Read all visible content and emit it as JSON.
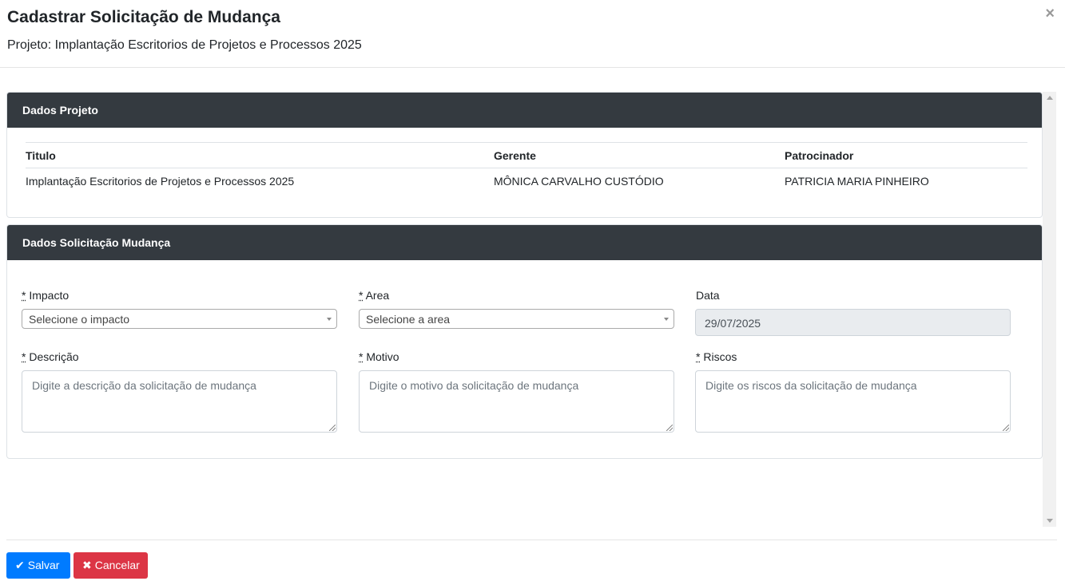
{
  "header": {
    "title": "Cadastrar Solicitação de Mudança",
    "subtitle": "Projeto: Implantação Escritorios de Projetos e Processos 2025",
    "close_symbol": "×"
  },
  "project_card": {
    "title": "Dados Projeto",
    "columns": [
      "Titulo",
      "Gerente",
      "Patrocinador"
    ],
    "row": [
      "Implantação Escritorios de Projetos e Processos 2025",
      "MÔNICA CARVALHO CUSTÓDIO",
      "PATRICIA MARIA PINHEIRO"
    ]
  },
  "request_card": {
    "title": "Dados Solicitação Mudança",
    "required_mark": "*",
    "impacto": {
      "label": "Impacto",
      "value": "Selecione o impacto"
    },
    "area": {
      "label": "Area",
      "value": "Selecione a area"
    },
    "data": {
      "label": "Data",
      "value": "29/07/2025"
    },
    "descricao": {
      "label": "Descrição",
      "placeholder": "Digite a descrição da solicitação de mudança"
    },
    "motivo": {
      "label": "Motivo",
      "placeholder": "Digite o motivo da solicitação de mudança"
    },
    "riscos": {
      "label": "Riscos",
      "placeholder": "Digite os riscos da solicitação de mudança"
    }
  },
  "footer": {
    "save_icon": "✔",
    "save_label": "Salvar",
    "cancel_icon": "✖",
    "cancel_label": "Cancelar"
  },
  "colors": {
    "card_header": "#343a40",
    "save_button": "#007bff",
    "cancel_button": "#dc3545"
  }
}
